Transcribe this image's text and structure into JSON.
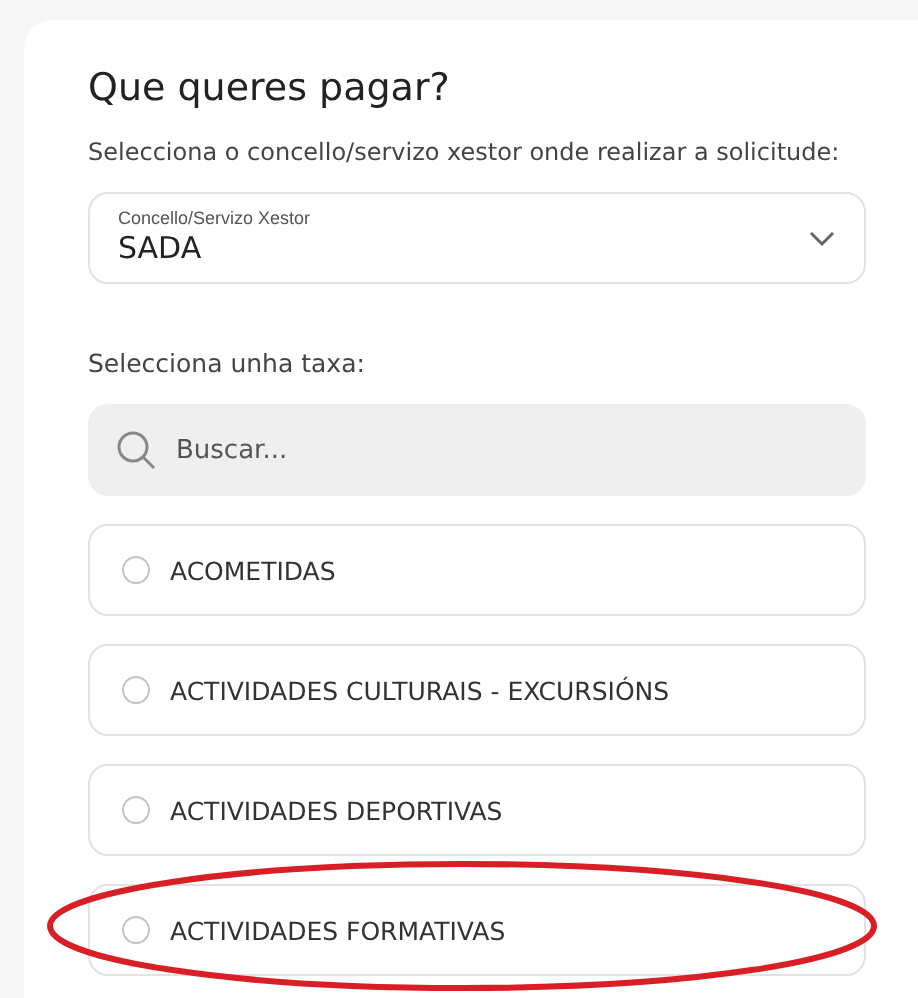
{
  "heading": "Que queres pagar?",
  "service_prompt": "Selecciona o concello/servizo xestor onde realizar a solicitude:",
  "service_select": {
    "label": "Concello/Servizo Xestor",
    "value": "SADA"
  },
  "fee_prompt": "Selecciona unha taxa:",
  "search": {
    "placeholder": "Buscar..."
  },
  "fees": [
    {
      "label": "ACOMETIDAS",
      "selected": false,
      "highlighted": false
    },
    {
      "label": "ACTIVIDADES CULTURAIS - EXCURSIÓNS",
      "selected": false,
      "highlighted": false
    },
    {
      "label": "ACTIVIDADES DEPORTIVAS",
      "selected": false,
      "highlighted": false
    },
    {
      "label": "ACTIVIDADES FORMATIVAS",
      "selected": false,
      "highlighted": true
    }
  ]
}
